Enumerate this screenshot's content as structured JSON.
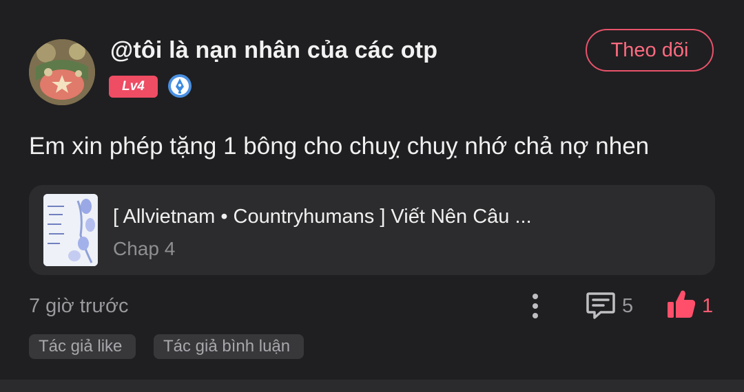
{
  "comment": {
    "username": "@tôi là nạn nhân của các otp",
    "level_badge": "Lv4",
    "follow_label": "Theo dõi",
    "text": "Em xin phép tặng 1 bông cho chuỵ chuỵ nhớ chả nợ nhen",
    "time": "7 giờ trước",
    "reply_count": "5",
    "like_count": "1"
  },
  "story": {
    "title": "[ Allvietnam • Countryhumans ] Viết Nên Câu ...",
    "chapter": "Chap 4"
  },
  "tags": [
    "Tác giả like",
    "Tác giả bình luận"
  ],
  "colors": {
    "background": "#1f1f21",
    "accent": "#ee4d64",
    "card": "#2c2c2e"
  },
  "icons": {
    "verify": "verified-pen-icon",
    "more": "more-vertical-icon",
    "reply": "comment-icon",
    "like": "thumbs-up-icon"
  }
}
